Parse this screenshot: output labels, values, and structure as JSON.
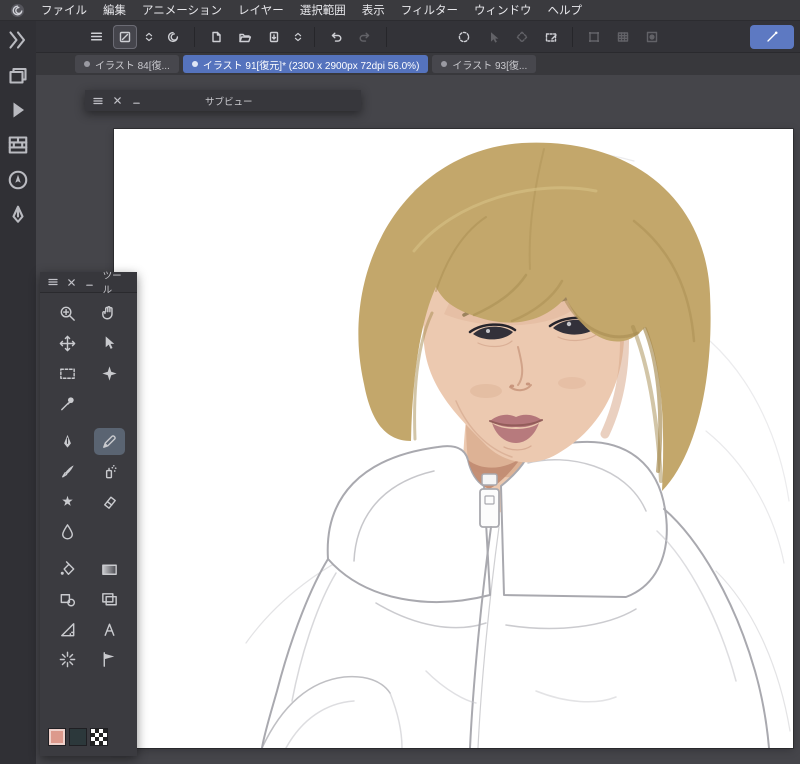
{
  "menubar": {
    "items": [
      "ファイル",
      "編集",
      "アニメーション",
      "レイヤー",
      "選択範囲",
      "表示",
      "フィルター",
      "ウィンドウ",
      "ヘルプ"
    ]
  },
  "sidebar": {
    "icons": [
      "collapse",
      "layers-panel",
      "auto-action-panel",
      "material-panel",
      "navigator-panel",
      "sub-tool-panel"
    ]
  },
  "toolbar": {
    "icons": [
      "main-menu",
      "tool-property",
      "property-stepper",
      "symmetry",
      "new-file",
      "open-file",
      "export",
      "export-stepper",
      "undo",
      "redo",
      "selection-launcher",
      "object-selector",
      "selection-invert",
      "selection-pen",
      "transform",
      "mesh-transform",
      "mask",
      "line-correction"
    ]
  },
  "tabs": {
    "items": [
      {
        "label": "イラスト 84[復...",
        "active": false
      },
      {
        "label": "イラスト 91[復元]* (2300 x 2900px 72dpi 56.0%)",
        "active": true
      },
      {
        "label": "イラスト 93[復...",
        "active": false
      }
    ]
  },
  "subview_panel": {
    "title": "サブビュー"
  },
  "tool_panel": {
    "title": "ツール",
    "tools": [
      "zoom",
      "hand",
      "move",
      "object",
      "marquee",
      "auto-select",
      "eyedropper",
      "pen",
      "pencil",
      "brush",
      "airbrush",
      "decoration",
      "eraser",
      "blend",
      "fill",
      "gradient",
      "shape",
      "frame",
      "ruler",
      "text",
      "radial-line",
      "stream-line"
    ],
    "selected_tool": "pencil",
    "colors": {
      "main": "#dc998c",
      "sub": "#2c383b",
      "transparent": "checker"
    }
  },
  "canvas": {
    "palette": {
      "hair-base": "#c3a76b",
      "hair-shadow": "#a68b50",
      "hair-light": "#dbc78c",
      "skin-base": "#ecc9b0",
      "skin-shadow": "#d8a98c",
      "skin-deep": "#c08a70",
      "eye-dark": "#33313a",
      "lash": "#26242c",
      "brow": "#8a744c",
      "lip-base": "#b4767a",
      "lip-dark": "#8f5a57",
      "sketch": "#a9a9af",
      "sketch-light": "#c7c7cc",
      "highlight": "#d5d6da"
    }
  }
}
